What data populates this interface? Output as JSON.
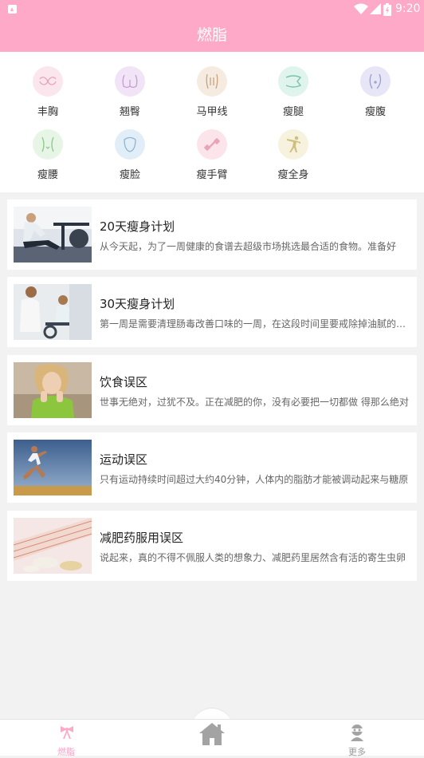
{
  "status_bar": {
    "time": "9:20"
  },
  "header": {
    "title": "燃脂"
  },
  "categories": [
    {
      "label": "丰胸",
      "icon": "chest-icon",
      "color": "#fce6ee"
    },
    {
      "label": "翘臀",
      "icon": "hips-icon",
      "color": "#f1e4f6"
    },
    {
      "label": "马甲线",
      "icon": "abs-icon",
      "color": "#f5ebe0"
    },
    {
      "label": "瘦腿",
      "icon": "legs-icon",
      "color": "#e0f4ee"
    },
    {
      "label": "瘦腹",
      "icon": "belly-icon",
      "color": "#e6e6f6"
    },
    {
      "label": "瘦腰",
      "icon": "waist-icon",
      "color": "#e6f5e6"
    },
    {
      "label": "瘦脸",
      "icon": "face-icon",
      "color": "#e2eef7"
    },
    {
      "label": "瘦手臂",
      "icon": "dumbbell-icon",
      "color": "#fbe4ea"
    },
    {
      "label": "瘦全身",
      "icon": "fullbody-icon",
      "color": "#f6f2de"
    }
  ],
  "plans": [
    {
      "title": "20天瘦身计划",
      "desc": "从今天起，为了一周健康的食谱去超级市场挑选最合适的食物。准备好",
      "image": "rowing-machine-photo"
    },
    {
      "title": "30天瘦身计划",
      "desc": "第一周是需要清理肠毒改善口味的一周，在这段时间里要戒除掉油腻的食物",
      "image": "exercise-bike-photo"
    },
    {
      "title": "饮食误区",
      "desc": "世事无绝对，过犹不及。正在减肥的你，没有必要把一切都做 得那么绝对",
      "image": "thinking-woman-photo"
    },
    {
      "title": "运动误区",
      "desc": "只有运动持续时间超过大约40分钟，人体内的脂肪才能被调动起来与糖原",
      "image": "runner-photo"
    },
    {
      "title": "减肥药服用误区",
      "desc": "说起来，真的不得不佩服人类的想象力、减肥药里居然含有活的寄生虫卵",
      "image": "measuring-tape-photo"
    }
  ],
  "tabbar": {
    "left_label": "燃脂",
    "right_label": "更多",
    "active_color": "#fda9c7",
    "inactive_color": "#999999"
  }
}
